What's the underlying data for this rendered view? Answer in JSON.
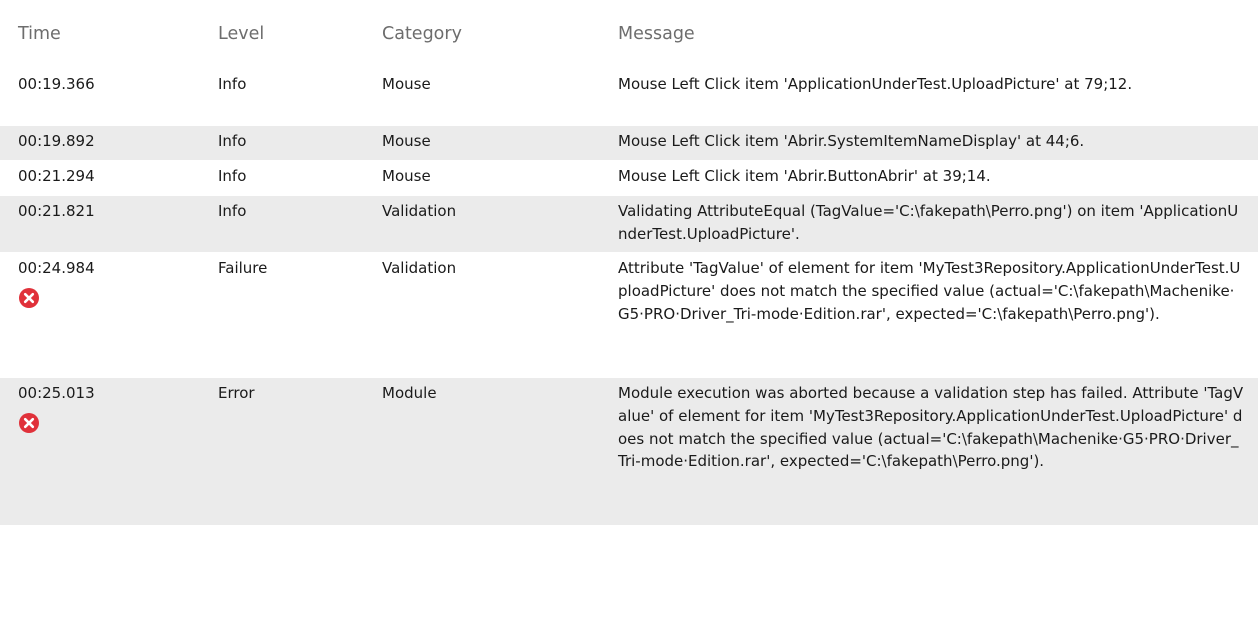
{
  "columns": {
    "time": "Time",
    "level": "Level",
    "category": "Category",
    "message": "Message"
  },
  "rows": [
    {
      "time": "00:19.366",
      "level": "Info",
      "category": "Mouse",
      "message": "Mouse Left Click item 'ApplicationUnderTest.UploadPicture' at 79;12.",
      "icon": null
    },
    {
      "time": "00:19.892",
      "level": "Info",
      "category": "Mouse",
      "message": "Mouse Left Click item 'Abrir.SystemItemNameDisplay' at 44;6.",
      "icon": null
    },
    {
      "time": "00:21.294",
      "level": "Info",
      "category": "Mouse",
      "message": "Mouse Left Click item 'Abrir.ButtonAbrir' at 39;14.",
      "icon": null
    },
    {
      "time": "00:21.821",
      "level": "Info",
      "category": "Validation",
      "message": "Validating AttributeEqual (TagValue='C:\\fakepath\\Perro.png') on item 'ApplicationUnderTest.UploadPicture'.",
      "icon": null
    },
    {
      "time": "00:24.984",
      "level": "Failure",
      "category": "Validation",
      "message": "Attribute 'TagValue' of element for item 'MyTest3Repository.ApplicationUnderTest.UploadPicture' does not match the specified value (actual='C:\\fakepath\\Machenike·G5·PRO·Driver_Tri-mode·Edition.rar', expected='C:\\fakepath\\Perro.png').",
      "icon": "error-icon"
    },
    {
      "time": "00:25.013",
      "level": "Error",
      "category": "Module",
      "message": "Module execution was aborted because a validation step has failed. Attribute 'TagValue' of element for item 'MyTest3Repository.ApplicationUnderTest.UploadPicture' does not match the specified value (actual='C:\\fakepath\\Machenike·G5·PRO·Driver_Tri-mode·Edition.rar', expected='C:\\fakepath\\Perro.png').",
      "icon": "error-icon"
    }
  ],
  "colors": {
    "header_text": "#6d6d6d",
    "row_alt_bg": "#ebebeb",
    "error_icon": "#e0313a"
  }
}
